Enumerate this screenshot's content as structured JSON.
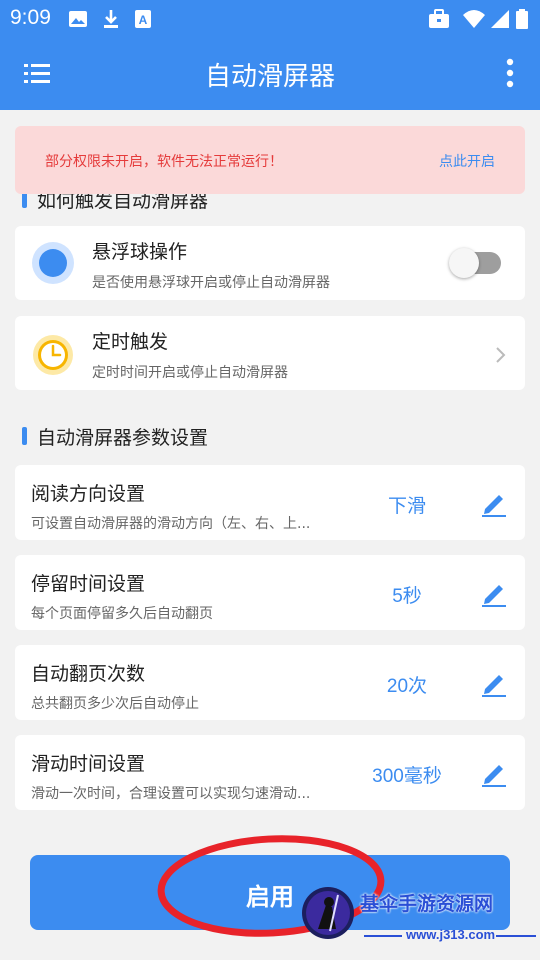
{
  "status_bar": {
    "time": "9:09",
    "left_icons": [
      "image-icon",
      "download-icon",
      "keyboard-a-icon"
    ],
    "right_icons": [
      "briefcase-icon",
      "wifi-icon",
      "signal-icon",
      "battery-icon"
    ]
  },
  "app_bar": {
    "title": "自动滑屏器",
    "menu_icon": "hamburger-menu-icon",
    "more_icon": "more-vertical-icon",
    "color": "#3c8cf0"
  },
  "alert": {
    "message": "部分权限未开启，软件无法正常运行！",
    "action": "点此开启"
  },
  "trigger_section": {
    "header": "如何触发自动滑屏器",
    "items": [
      {
        "title": "悬浮球操作",
        "subtitle": "是否使用悬浮球开启或停止自动滑屏器",
        "icon": "floating-ball-icon",
        "toggle_on": false
      },
      {
        "title": "定时触发",
        "subtitle": "定时时间开启或停止自动滑屏器",
        "icon": "clock-icon"
      }
    ]
  },
  "params_section": {
    "header": "自动滑屏器参数设置",
    "items": [
      {
        "title": "阅读方向设置",
        "subtitle": "可设置自动滑屏器的滑动方向（左、右、上...",
        "value": "下滑"
      },
      {
        "title": "停留时间设置",
        "subtitle": "每个页面停留多久后自动翻页",
        "value": "5秒"
      },
      {
        "title": "自动翻页次数",
        "subtitle": "总共翻页多少次后自动停止",
        "value": "20次"
      },
      {
        "title": "滑动时间设置",
        "subtitle": "滑动一次时间，合理设置可以实现匀速滑动...",
        "value": "300毫秒"
      }
    ]
  },
  "enable_button": {
    "label": "启用"
  },
  "watermark": {
    "text": "基伞手游资源网",
    "url": "www.j313.com"
  },
  "colors": {
    "accent": "#3c8cf0",
    "alert_bg": "#fbd9d9",
    "alert_text": "#e53b3b",
    "annotation": "#e8232a"
  }
}
